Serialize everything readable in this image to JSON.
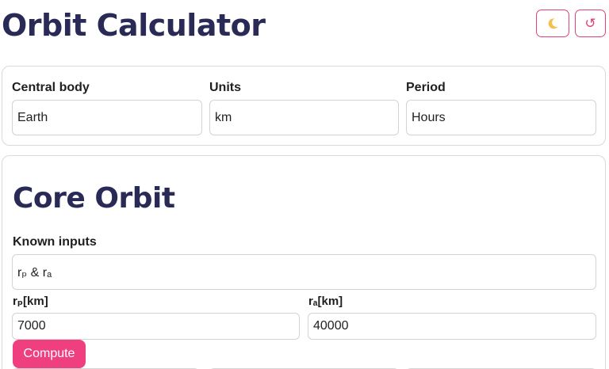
{
  "header": {
    "title": "Orbit Calculator",
    "theme_icon": "moon-icon",
    "reset_icon": "refresh-icon",
    "reset_glyph": "↺"
  },
  "settings": {
    "central_body_label": "Central body",
    "central_body_value": "Earth",
    "units_label": "Units",
    "units_value": "km",
    "period_label": "Period",
    "period_value": "Hours"
  },
  "core": {
    "title": "Core Orbit",
    "known_inputs_label": "Known inputs",
    "known_inputs_value": "rₚ & rₐ",
    "rp_label": "rₚ[km]",
    "rp_value": "7000",
    "ra_label": "rₐ[km]",
    "ra_value": "40000",
    "compute_label": "Compute"
  },
  "colors": {
    "accent": "#ef3f7e",
    "title": "#2a2a56",
    "moon": "#f2c14e"
  }
}
